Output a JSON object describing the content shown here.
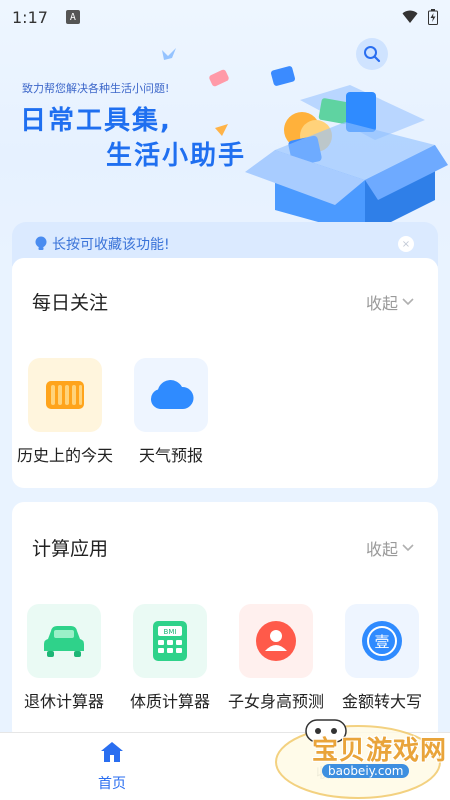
{
  "status_bar": {
    "time": "1:17",
    "notification_letter": "A"
  },
  "hero": {
    "subtitle": "致力帮您解决各种生活小问题!",
    "title_line1": "日常工具集,",
    "title_line2": "生活小助手"
  },
  "tip": {
    "text": "长按可收藏该功能!"
  },
  "daily": {
    "title": "每日关注",
    "collapse_label": "收起",
    "items": [
      {
        "label": "历史上的今天",
        "icon": "scroll-icon"
      },
      {
        "label": "天气预报",
        "icon": "cloud-icon"
      }
    ]
  },
  "calc": {
    "title": "计算应用",
    "collapse_label": "收起",
    "items": [
      {
        "label": "退休计算器",
        "icon": "car-icon"
      },
      {
        "label": "体质计算器",
        "icon": "bmi-calculator-icon",
        "icon_text": "BMI"
      },
      {
        "label": "子女身高预测",
        "icon": "person-icon"
      },
      {
        "label": "金额转大写",
        "icon": "yuan-convert-icon",
        "icon_text": "壹"
      }
    ]
  },
  "bottom_nav": {
    "home_label": "首页",
    "favorites_label": "收藏"
  },
  "watermark": {
    "title": "宝贝游戏网",
    "url": "baobeiy.com"
  },
  "colors": {
    "accent": "#2a6ef0",
    "title_blue": "#1f6ff0",
    "tip_bg": "#dbeaff"
  }
}
